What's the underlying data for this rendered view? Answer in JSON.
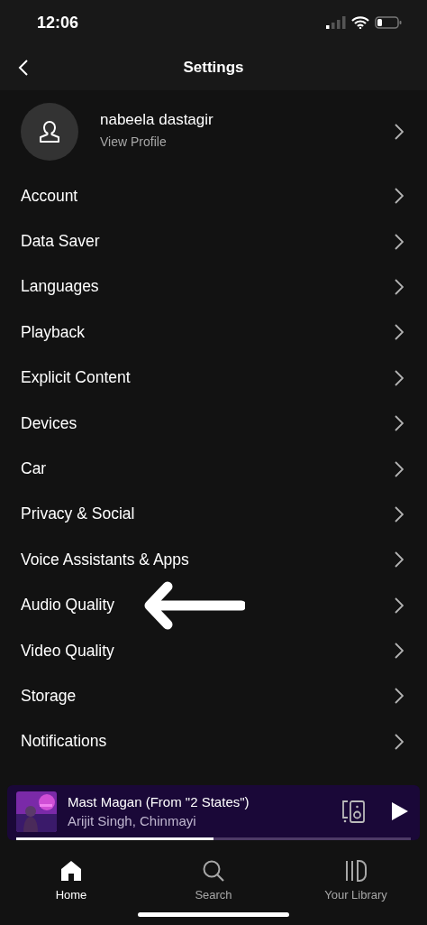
{
  "status_bar": {
    "time": "12:06"
  },
  "header": {
    "title": "Settings"
  },
  "profile": {
    "name": "nabeela dastagir",
    "subtitle": "View Profile"
  },
  "settings": [
    {
      "label": "Account"
    },
    {
      "label": "Data Saver"
    },
    {
      "label": "Languages"
    },
    {
      "label": "Playback"
    },
    {
      "label": "Explicit Content"
    },
    {
      "label": "Devices"
    },
    {
      "label": "Car"
    },
    {
      "label": "Privacy & Social"
    },
    {
      "label": "Voice Assistants & Apps"
    },
    {
      "label": "Audio Quality",
      "annotated": true
    },
    {
      "label": "Video Quality"
    },
    {
      "label": "Storage"
    },
    {
      "label": "Notifications"
    }
  ],
  "now_playing": {
    "title": "Mast Magan (From \"2 States\")",
    "artist": "Arijit Singh, Chinmayi",
    "level": 0.5
  },
  "tabs": [
    {
      "label": "Home",
      "kind": "home",
      "selected": true
    },
    {
      "label": "Search",
      "kind": "search",
      "selected": false
    },
    {
      "label": "Your Library",
      "kind": "library",
      "selected": false
    }
  ]
}
